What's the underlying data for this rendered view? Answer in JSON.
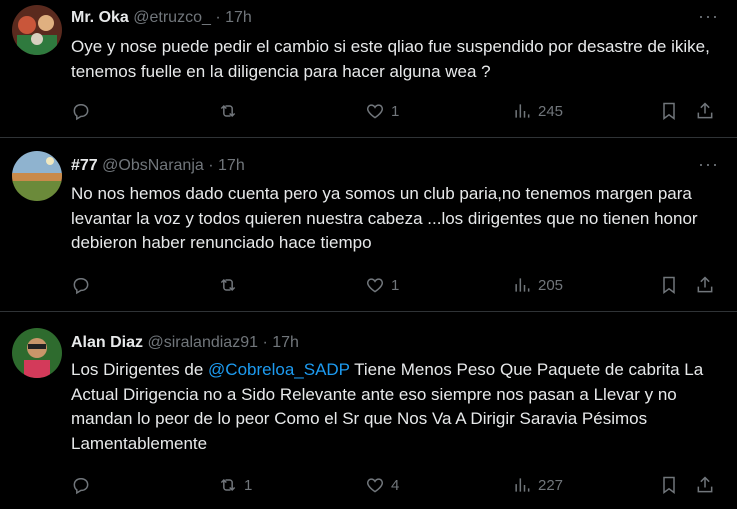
{
  "tweets": [
    {
      "name": "Mr. Oka",
      "handle": "@etruzco_",
      "separator": "·",
      "time": "17h",
      "text": "Oye y nose puede pedir el cambio si este qliao fue suspendido por desastre de ikike, tenemos fuelle en la diligencia para hacer alguna wea ?",
      "mention": "",
      "text_after": "",
      "replies": "",
      "reposts": "",
      "likes": "1",
      "views": "245",
      "avatar_colors": [
        "#7a3b2a",
        "#c9563a",
        "#2f7a3e"
      ]
    },
    {
      "name": "#77",
      "handle": "@ObsNaranja",
      "separator": "·",
      "time": "17h",
      "text": "No nos hemos dado cuenta pero ya somos un club paria,no tenemos margen para levantar la voz y todos quieren nuestra cabeza ...los dirigentes que no tienen honor debieron haber renunciado hace tiempo",
      "mention": "",
      "text_after": "",
      "replies": "",
      "reposts": "",
      "likes": "1",
      "views": "205",
      "avatar_colors": [
        "#8fb3cf",
        "#c98a4a",
        "#6b8a3a"
      ]
    },
    {
      "name": "Alan Diaz",
      "handle": "@siralandiaz91",
      "separator": "·",
      "time": "17h",
      "text": "Los Dirigentes de ",
      "mention": "@Cobreloa_SADP",
      "text_after": " Tiene Menos Peso Que Paquete de cabrita La Actual Dirigencia no a Sido Relevante ante eso siempre nos pasan a Llevar y no mandan lo peor de lo peor Como el Sr que Nos Va A Dirigir Saravia Pésimos Lamentablemente",
      "replies": "",
      "reposts": "1",
      "likes": "4",
      "views": "227",
      "avatar_colors": [
        "#2e6b2e",
        "#d33a5a",
        "#3a3a3a"
      ]
    }
  ],
  "icons": {
    "more": "more-icon",
    "reply": "reply-icon",
    "repost": "repost-icon",
    "like": "heart-icon",
    "views": "views-icon",
    "bookmark": "bookmark-icon",
    "share": "share-icon"
  }
}
